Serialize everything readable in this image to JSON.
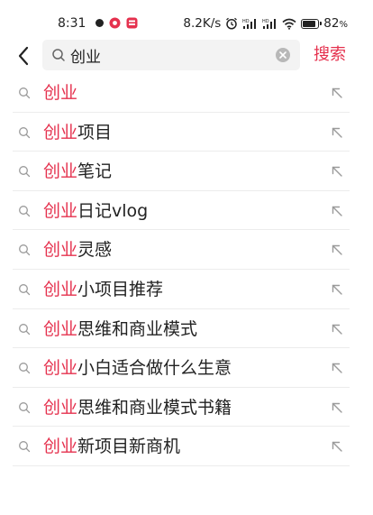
{
  "status_bar": {
    "time": "8:31",
    "network_speed": "8.2K/s",
    "battery_percent": "82",
    "battery_suffix": "%",
    "icons": [
      "dot-icon",
      "app-badge-icon",
      "app-badge-icon",
      "alarm-icon",
      "signal-icon",
      "signal-icon",
      "wifi-icon",
      "battery-icon"
    ]
  },
  "search": {
    "query": "创业",
    "submit_label": "搜索",
    "icons": [
      "back-arrow-icon",
      "search-icon",
      "clear-icon"
    ]
  },
  "suggestions": [
    {
      "highlight": "创业",
      "rest": ""
    },
    {
      "highlight": "创业",
      "rest": "项目"
    },
    {
      "highlight": "创业",
      "rest": "笔记"
    },
    {
      "highlight": "创业",
      "rest": "日记vlog"
    },
    {
      "highlight": "创业",
      "rest": "灵感"
    },
    {
      "highlight": "创业",
      "rest": "小项目推荐"
    },
    {
      "highlight": "创业",
      "rest": "思维和商业模式"
    },
    {
      "highlight": "创业",
      "rest": "小白适合做什么生意"
    },
    {
      "highlight": "创业",
      "rest": "思维和商业模式书籍"
    },
    {
      "highlight": "创业",
      "rest": "新项目新商机"
    }
  ],
  "colors": {
    "accent": "#e5314e",
    "text": "#222222",
    "search_bg": "#f3f3f3",
    "divider": "#ececec"
  }
}
